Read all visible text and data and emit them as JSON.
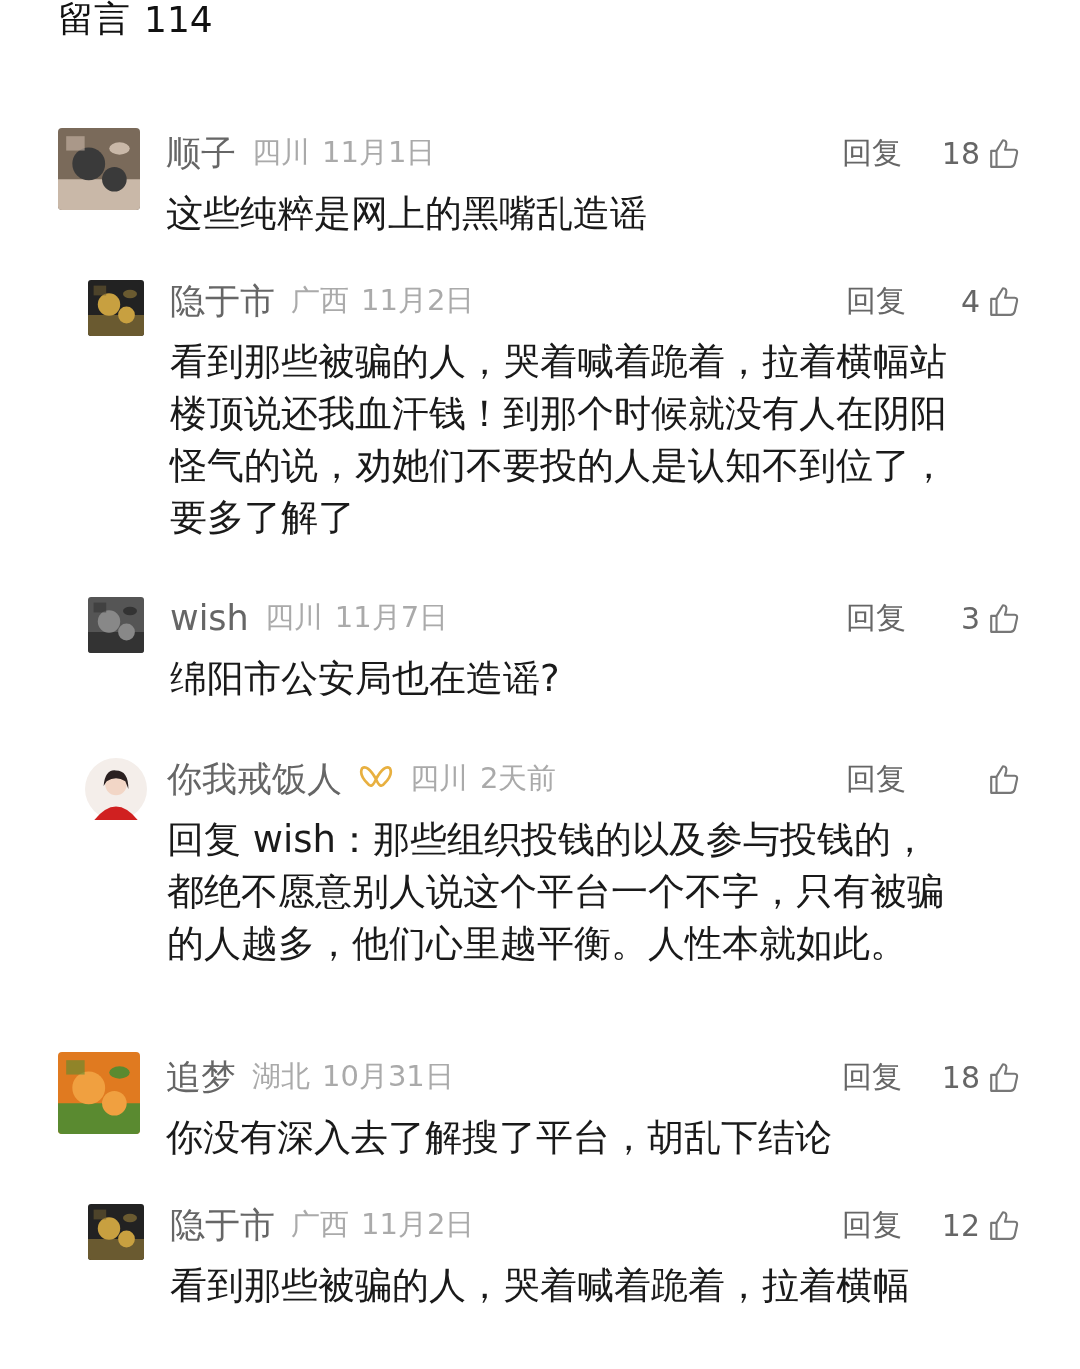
{
  "header": {
    "title": "留言",
    "count": "114"
  },
  "comments": [
    {
      "avatar": {
        "kind": "picture"
      },
      "name": "顺子",
      "region": "四川",
      "date": "11月1日",
      "reply": "回复",
      "likes": "18",
      "text": "这些纯粹是网上的黑嘴乱造谣",
      "children": [
        {
          "avatar": {
            "kind": "picture"
          },
          "name": "隐于市",
          "region": "广西",
          "date": "11月2日",
          "reply": "回复",
          "likes": "4",
          "text": "看到那些被骗的人，哭着喊着跪着，拉着横幅站楼顶说还我血汗钱！到那个时候就没有人在阴阳怪气的说，劝她们不要投的人是认知不到位了，要多了解了"
        },
        {
          "avatar": {
            "kind": "picture"
          },
          "name": "wish",
          "region": "四川",
          "date": "11月7日",
          "reply": "回复",
          "likes": "3",
          "text": "绵阳市公安局也在造谣?"
        },
        {
          "avatar": {
            "kind": "figure"
          },
          "name": "你我戒饭人",
          "badge": true,
          "region": "四川",
          "date": "2天前",
          "reply": "回复",
          "text": "回复 wish：那些组织投钱的以及参与投钱的，都绝不愿意别人说这个平台一个不字，只有被骗的人越多，他们心里越平衡。人性本就如此。"
        }
      ]
    },
    {
      "avatar": {
        "kind": "picture"
      },
      "name": "追梦",
      "region": "湖北",
      "date": "10月31日",
      "reply": "回复",
      "likes": "18",
      "text": "你没有深入去了解搜了平台，胡乱下结论",
      "children": [
        {
          "avatar": {
            "kind": "picture"
          },
          "name": "隐于市",
          "region": "广西",
          "date": "11月2日",
          "reply": "回复",
          "likes": "12",
          "text": "看到那些被骗的人，哭着喊着跪着，拉着横幅"
        }
      ]
    }
  ]
}
